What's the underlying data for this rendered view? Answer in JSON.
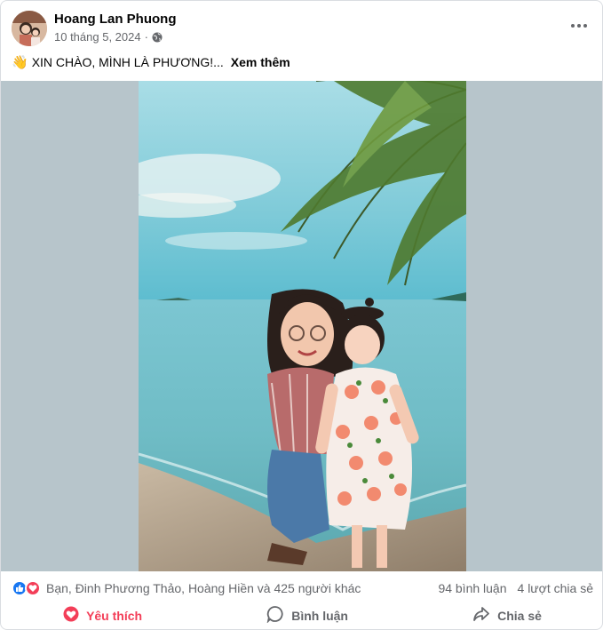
{
  "post": {
    "author": "Hoang Lan Phuong",
    "date": "10 tháng 5, 2024",
    "separator": "·",
    "privacy_icon": "globe-icon",
    "caption_emoji": "👋",
    "caption_text": "XIN CHÀO, MÌNH LÀ PHƯƠNG!...",
    "see_more": "Xem thêm"
  },
  "stats": {
    "reactions_text": "Bạn, Đinh Phương Thảo, Hoàng Hiền và 425 người khác",
    "comments": "94 bình luận",
    "shares": "4 lượt chia sẻ",
    "reaction_icons": [
      "like-icon",
      "love-icon"
    ]
  },
  "actions": {
    "love_label": "Yêu thích",
    "comment_label": "Bình luận",
    "share_label": "Chia sẻ"
  },
  "colors": {
    "love": "#f33e58",
    "like": "#1877f2",
    "secondary_text": "#65676b"
  }
}
